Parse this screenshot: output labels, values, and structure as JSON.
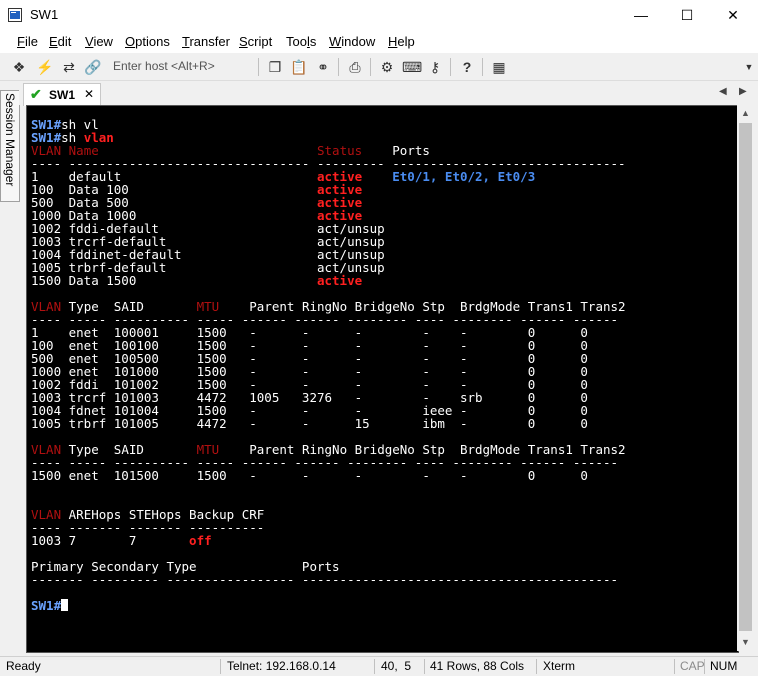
{
  "window": {
    "title": "SW1"
  },
  "menu": [
    "File",
    "Edit",
    "View",
    "Options",
    "Transfer",
    "Script",
    "Tools",
    "Window",
    "Help"
  ],
  "menu_mnemonic": [
    "F",
    "E",
    "V",
    "O",
    "T",
    "S",
    "l",
    "W",
    "H"
  ],
  "toolbar": {
    "enter_host_label": "Enter host <Alt+R>"
  },
  "sidebar": {
    "session_manager_label": "Session Manager"
  },
  "tabs": [
    {
      "label": "SW1",
      "status_color": "#22a322"
    }
  ],
  "terminal": {
    "colors": {
      "background": "#000000",
      "prompt": "#6aa2ff",
      "status_active": "#ff2020",
      "header_highlight": "#b01010",
      "ports": "#4a8cf0"
    },
    "prompt": "SW1#",
    "commands": [
      "sh vl",
      "sh vlan"
    ],
    "vlan_table": {
      "headers": [
        "VLAN",
        "Name",
        "Status",
        "Ports"
      ],
      "rows": [
        {
          "vlan": "1",
          "name": "default",
          "status": "active",
          "ports": "Et0/1, Et0/2, Et0/3"
        },
        {
          "vlan": "100",
          "name": "Data 100",
          "status": "active",
          "ports": ""
        },
        {
          "vlan": "500",
          "name": "Data 500",
          "status": "active",
          "ports": ""
        },
        {
          "vlan": "1000",
          "name": "Data 1000",
          "status": "active",
          "ports": ""
        },
        {
          "vlan": "1002",
          "name": "fddi-default",
          "status": "act/unsup",
          "ports": ""
        },
        {
          "vlan": "1003",
          "name": "trcrf-default",
          "status": "act/unsup",
          "ports": ""
        },
        {
          "vlan": "1004",
          "name": "fddinet-default",
          "status": "act/unsup",
          "ports": ""
        },
        {
          "vlan": "1005",
          "name": "trbrf-default",
          "status": "act/unsup",
          "ports": ""
        },
        {
          "vlan": "1500",
          "name": "Data 1500",
          "status": "active",
          "ports": ""
        }
      ]
    },
    "detail_headers": [
      "VLAN",
      "Type",
      "SAID",
      "MTU",
      "Parent",
      "RingNo",
      "BridgeNo",
      "Stp",
      "BrdgMode",
      "Trans1",
      "Trans2"
    ],
    "detail_rows": [
      [
        "1",
        "enet",
        "100001",
        "1500",
        "-",
        "-",
        "-",
        "-",
        "-",
        "0",
        "0"
      ],
      [
        "100",
        "enet",
        "100100",
        "1500",
        "-",
        "-",
        "-",
        "-",
        "-",
        "0",
        "0"
      ],
      [
        "500",
        "enet",
        "100500",
        "1500",
        "-",
        "-",
        "-",
        "-",
        "-",
        "0",
        "0"
      ],
      [
        "1000",
        "enet",
        "101000",
        "1500",
        "-",
        "-",
        "-",
        "-",
        "-",
        "0",
        "0"
      ],
      [
        "1002",
        "fddi",
        "101002",
        "1500",
        "-",
        "-",
        "-",
        "-",
        "-",
        "0",
        "0"
      ],
      [
        "1003",
        "trcrf",
        "101003",
        "4472",
        "1005",
        "3276",
        "-",
        "-",
        "srb",
        "0",
        "0"
      ],
      [
        "1004",
        "fdnet",
        "101004",
        "1500",
        "-",
        "-",
        "-",
        "ieee",
        "-",
        "0",
        "0"
      ],
      [
        "1005",
        "trbrf",
        "101005",
        "4472",
        "-",
        "-",
        "15",
        "ibm",
        "-",
        "0",
        "0"
      ]
    ],
    "detail2_rows": [
      [
        "1500",
        "enet",
        "101500",
        "1500",
        "-",
        "-",
        "-",
        "-",
        "-",
        "0",
        "0"
      ]
    ],
    "hops_headers": [
      "VLAN",
      "AREHops",
      "STEHops",
      "Backup CRF"
    ],
    "hops_rows": [
      [
        "1003",
        "7",
        "7",
        "off"
      ]
    ],
    "pvlan_headers": [
      "Primary",
      "Secondary",
      "Type",
      "Ports"
    ]
  },
  "statusbar": {
    "ready": "Ready",
    "connection": "Telnet: 192.168.0.14",
    "position": "40,  5",
    "size": "41 Rows, 88 Cols",
    "emulation": "Xterm",
    "cap": "CAP",
    "num": "NUM"
  }
}
